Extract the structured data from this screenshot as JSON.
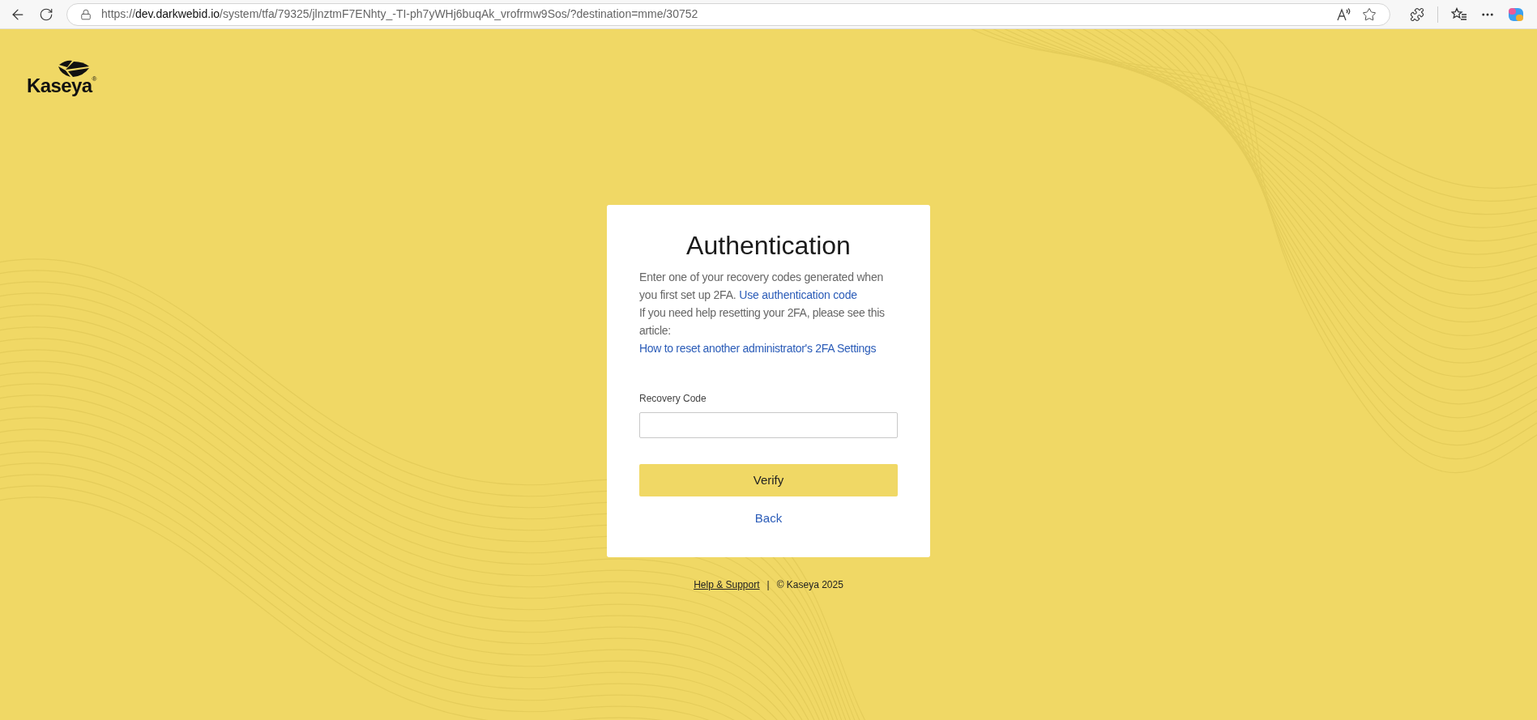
{
  "browser": {
    "url": {
      "scheme": "https://",
      "host": "dev.darkwebid.io",
      "path": "/system/tfa/79325/jlnztmF7ENhty_-TI-ph7yWHj6buqAk_vrofrmw9Sos/?destination=mme/30752"
    }
  },
  "logo": {
    "text": "Kaseya",
    "mark": "®"
  },
  "card": {
    "title": "Authentication",
    "intro": {
      "text": "Enter one of your recovery codes generated when you first set up 2FA. ",
      "link": "Use authentication code"
    },
    "help": {
      "text": "If you need help resetting your 2FA, please see this article: ",
      "link": "How to reset another administrator's 2FA Settings"
    },
    "field": {
      "label": "Recovery Code"
    },
    "submit": "Verify",
    "back": "Back"
  },
  "footer": {
    "link": "Help & Support",
    "separator": "|",
    "copyright": "© Kaseya 2025"
  }
}
